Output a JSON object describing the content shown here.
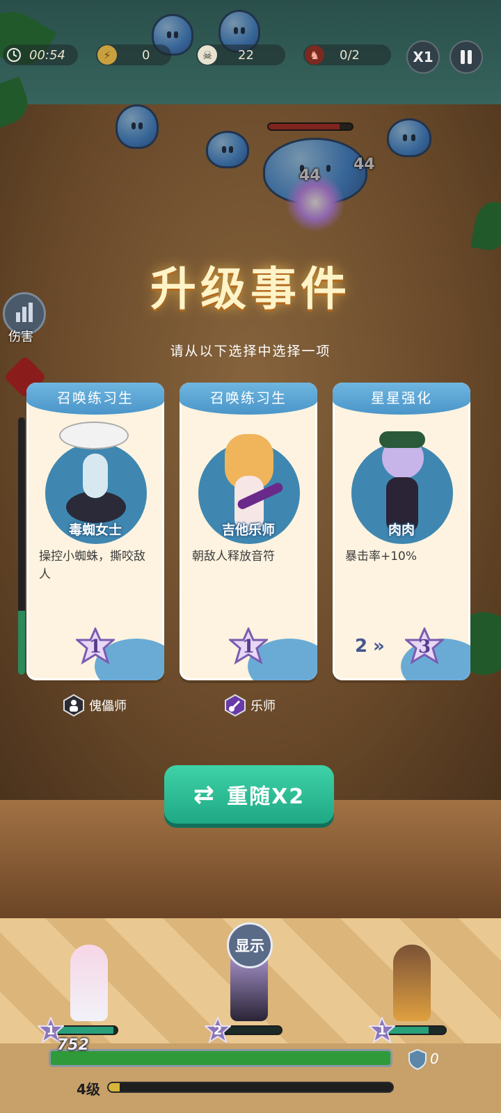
{
  "hud": {
    "timer": "00:54",
    "coins": "0",
    "kills": "22",
    "boss_progress": "0/2",
    "speed_label": "X1"
  },
  "enemies": {
    "damage_numbers": [
      "44",
      "44"
    ]
  },
  "side": {
    "damage_label": "伤害"
  },
  "event": {
    "title": "升级事件",
    "subtitle": "请从以下选择中选择一项"
  },
  "cards": [
    {
      "header": "召唤练习生",
      "name": "毒蜘女士",
      "description": "操控小蜘蛛，撕咬敌人",
      "star_level": "1",
      "class_name": "傀儡师"
    },
    {
      "header": "召唤练习生",
      "name": "吉他乐师",
      "description": "朝敌人释放音符",
      "star_level": "1",
      "class_name": "乐师"
    },
    {
      "header": "星星强化",
      "name": "肉肉",
      "description": "暴击率+10%",
      "star_from": "2",
      "star_level": "3"
    }
  ],
  "reroll": {
    "label": "重随X2"
  },
  "party": {
    "show_label": "显示",
    "heroes": [
      {
        "star": "1",
        "hp_fraction": 0.95
      },
      {
        "star": "2",
        "hp_fraction": 0.0
      },
      {
        "star": "1",
        "hp_fraction": 0.75
      }
    ],
    "base_hp": "752",
    "base_hp_fraction": 1.0,
    "shield": "0",
    "level_label": "4级",
    "xp_fraction": 0.04
  },
  "colors": {
    "accent_teal": "#1fa884",
    "card_header": "#4a95c9",
    "title_glow": "#ffc850"
  }
}
